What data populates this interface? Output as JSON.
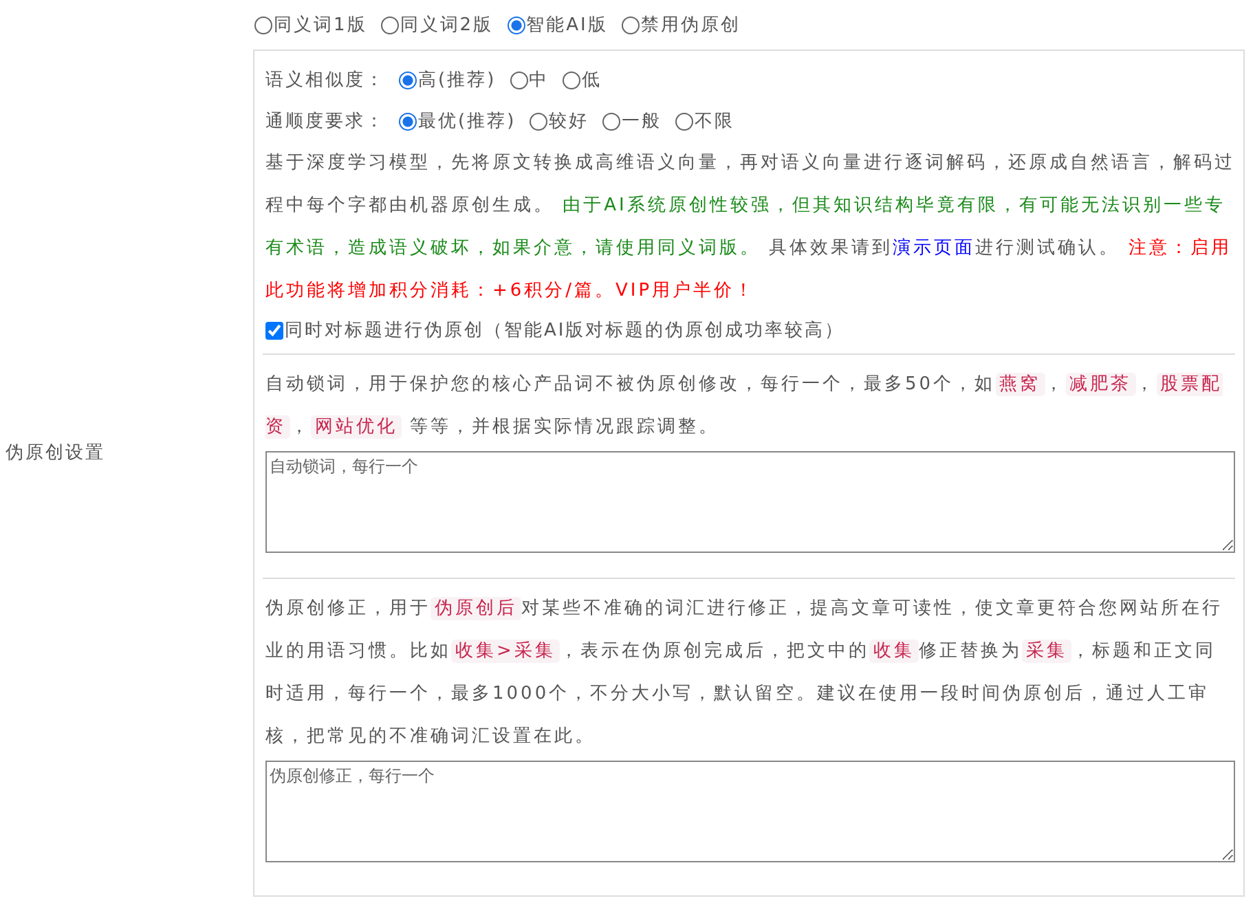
{
  "side_label": "伪原创设置",
  "modes": [
    {
      "label": "同义词1版",
      "selected": false
    },
    {
      "label": "同义词2版",
      "selected": false
    },
    {
      "label": "智能AI版",
      "selected": true
    },
    {
      "label": "禁用伪原创",
      "selected": false
    }
  ],
  "similarity": {
    "label": "语义相似度：",
    "options": [
      {
        "label": "高(推荐)",
        "selected": true
      },
      {
        "label": "中",
        "selected": false
      },
      {
        "label": "低",
        "selected": false
      }
    ]
  },
  "fluency": {
    "label": "通顺度要求：",
    "options": [
      {
        "label": "最优(推荐)",
        "selected": true
      },
      {
        "label": "较好",
        "selected": false
      },
      {
        "label": "一般",
        "selected": false
      },
      {
        "label": "不限",
        "selected": false
      }
    ]
  },
  "ai_note": [
    {
      "kind": "plain",
      "text": "基于深度学习模型，先将原文转换成高维语义向量，再对语义向量进行逐词解码，还原成自然语言，解码过程中每个字都由机器原创生成。 "
    },
    {
      "kind": "notice",
      "text": "由于AI系统原创性较强，但其知识结构毕竟有限，有可能无法识别一些专有术语，造成语义破坏，如果介意，请使用同义词版。"
    },
    {
      "kind": "plain",
      "text": " 具体效果请到"
    },
    {
      "kind": "link",
      "text": "演示页面"
    },
    {
      "kind": "plain",
      "text": "进行测试确认。 "
    },
    {
      "kind": "warning",
      "text": "注意：启用此功能将增加积分消耗：+6积分/篇。VIP用户半价！"
    }
  ],
  "title_option": {
    "label": "同时对标题进行伪原创（智能AI版对标题的伪原创成功率较高）",
    "checked": true
  },
  "lock_words": {
    "text": [
      {
        "kind": "plain",
        "text": "自动锁词，用于保护您的核心产品词不被伪原创修改，每行一个，最多50个，如"
      },
      {
        "kind": "tag",
        "text": "燕窝"
      },
      {
        "kind": "plain",
        "text": "，"
      },
      {
        "kind": "tag",
        "text": "减肥茶"
      },
      {
        "kind": "plain",
        "text": "，"
      },
      {
        "kind": "tag",
        "text": "股票配资"
      },
      {
        "kind": "plain",
        "text": "，"
      },
      {
        "kind": "tag",
        "text": "网站优化"
      },
      {
        "kind": "plain",
        "text": " 等等，并根据实际情况跟踪调整。"
      }
    ],
    "placeholder": "自动锁词，每行一个"
  },
  "correction": {
    "text": [
      {
        "kind": "plain",
        "text": "伪原创修正，用于"
      },
      {
        "kind": "tag",
        "text": "伪原创后"
      },
      {
        "kind": "plain",
        "text": "对某些不准确的词汇进行修正，提高文章可读性，使文章更符合您网站所在行业的用语习惯。比如"
      },
      {
        "kind": "tag",
        "text": "收集>采集"
      },
      {
        "kind": "plain",
        "text": "，表示在伪原创完成后，把文中的"
      },
      {
        "kind": "tag",
        "text": "收集"
      },
      {
        "kind": "plain",
        "text": "修正替换为"
      },
      {
        "kind": "tag",
        "text": "采集"
      },
      {
        "kind": "plain",
        "text": "，标题和正文同时适用，每行一个，最多1000个，不分大小写，默认留空。建议在使用一段时间伪原创后，通过人工审核，把常见的不准确词汇设置在此。"
      }
    ],
    "placeholder": "伪原创修正，每行一个"
  }
}
